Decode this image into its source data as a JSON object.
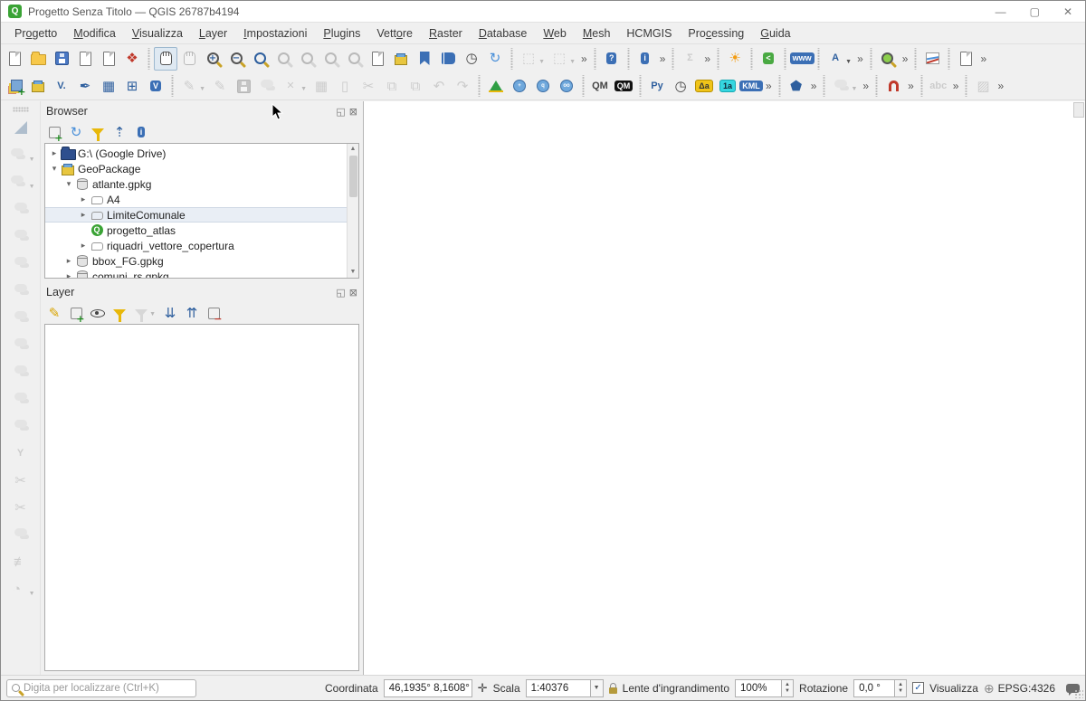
{
  "window": {
    "title": "Progetto Senza Titolo — QGIS 26787b4194",
    "logo_letter": "Q",
    "minimize": "—",
    "maximize": "▢",
    "close": "✕"
  },
  "menubar": [
    {
      "label": "Progetto",
      "u": 2
    },
    {
      "label": "Modifica",
      "u": 0
    },
    {
      "label": "Visualizza",
      "u": 0
    },
    {
      "label": "Layer",
      "u": 0
    },
    {
      "label": "Impostazioni",
      "u": 0
    },
    {
      "label": "Plugins",
      "u": 0
    },
    {
      "label": "Vettore",
      "u": 4
    },
    {
      "label": "Raster",
      "u": 0
    },
    {
      "label": "Database",
      "u": 0
    },
    {
      "label": "Web",
      "u": 0
    },
    {
      "label": "Mesh",
      "u": 0
    },
    {
      "label": "HCMGIS",
      "u": -1
    },
    {
      "label": "Processing",
      "u": 3
    },
    {
      "label": "Guida",
      "u": 0
    }
  ],
  "toolbar_main": [
    {
      "n": "new-project",
      "sh": "sh-doc"
    },
    {
      "n": "open-project",
      "sh": "sh-folder"
    },
    {
      "n": "save-project",
      "sh": "sh-floppy"
    },
    {
      "n": "new-print-layout",
      "sh": "sh-doc"
    },
    {
      "n": "layout-manager",
      "sh": "sh-doc"
    },
    {
      "n": "style-manager",
      "g": "❖",
      "st": "c-red g"
    },
    {
      "sep": true
    },
    {
      "n": "pan-map",
      "sh": "sh-hand",
      "pressed": true
    },
    {
      "n": "pan-to-selection",
      "sh": "sh-hand",
      "dis": true
    },
    {
      "n": "zoom-in",
      "sh": "sh-mag",
      "g": "+"
    },
    {
      "n": "zoom-out",
      "sh": "sh-mag",
      "g": "−"
    },
    {
      "n": "zoom-full-extent",
      "sh": "sh-mag full"
    },
    {
      "n": "zoom-to-selection",
      "sh": "sh-mag",
      "dis": true
    },
    {
      "n": "zoom-to-layer",
      "sh": "sh-mag",
      "dis": true
    },
    {
      "n": "zoom-last",
      "sh": "sh-mag",
      "dis": true
    },
    {
      "n": "zoom-next",
      "sh": "sh-mag",
      "dis": true
    },
    {
      "n": "new-map-view",
      "sh": "sh-doc"
    },
    {
      "n": "new-3d-map-view",
      "sh": "sh-box3d"
    },
    {
      "n": "new-spatial-bookmark",
      "sh": "sh-bkm"
    },
    {
      "n": "show-bookmarks",
      "sh": "sh-book"
    },
    {
      "n": "temporal-controller",
      "g": "◷",
      "st": "c-dark g"
    },
    {
      "n": "refresh-map",
      "g": "↻",
      "st": "c-lblue g"
    },
    {
      "sep": true
    },
    {
      "n": "select-features",
      "g": "⬚",
      "st": "c-grey g",
      "dis": true,
      "dd": true
    },
    {
      "n": "deselect-features",
      "g": "⬚",
      "st": "c-grey g",
      "dis": true,
      "dd": true
    },
    {
      "n": "overflow",
      "g": "»",
      "ovf": true
    },
    {
      "sep": true
    },
    {
      "n": "help-contents",
      "g": "?",
      "st": "chip bg-blue"
    },
    {
      "sep": true
    },
    {
      "n": "identify-features",
      "g": "i",
      "st": "chip bg-blue"
    },
    {
      "n": "overflow",
      "g": "»",
      "ovf": true
    },
    {
      "sep": true
    },
    {
      "n": "statistical-summary",
      "g": "Σ",
      "st": "c-grey g small",
      "dis": true
    },
    {
      "n": "overflow",
      "g": "»",
      "ovf": true
    },
    {
      "sep": true
    },
    {
      "n": "sun-plugin",
      "g": "☀",
      "st": "c-orange g"
    },
    {
      "sep": true
    },
    {
      "n": "share-plugin",
      "g": "<",
      "st": "chip bg-green"
    },
    {
      "sep": true
    },
    {
      "n": "web-plugin",
      "g": "www",
      "st": "chip bg-blue"
    },
    {
      "sep": true
    },
    {
      "n": "labeling",
      "g": "A",
      "st": "c-blue g small",
      "dd": true
    },
    {
      "n": "overflow",
      "g": "»",
      "ovf": true
    },
    {
      "sep": true
    },
    {
      "n": "search-layers-plugin",
      "sh": "sh-mag",
      "stw": "bg-lgreen"
    },
    {
      "n": "overflow",
      "g": "»",
      "ovf": true
    },
    {
      "sep": true
    },
    {
      "n": "profile-tool",
      "sh": "sh-chart"
    },
    {
      "sep": true
    },
    {
      "n": "duplicate-layout",
      "sh": "sh-doc"
    },
    {
      "n": "overflow",
      "g": "»",
      "ovf": true
    }
  ],
  "toolbar_data": [
    {
      "n": "data-source-manager",
      "sh": "sh-stack"
    },
    {
      "n": "new-geopackage",
      "sh": "sh-box3d"
    },
    {
      "n": "new-vector-layer",
      "g": "V.",
      "st": "c-blue g small"
    },
    {
      "n": "new-shapefile",
      "g": "✒",
      "st": "c-blue g"
    },
    {
      "n": "new-spatialite-layer",
      "g": "▦",
      "st": "c-blue g"
    },
    {
      "n": "new-grid-layer",
      "g": "⊞",
      "st": "c-blue g"
    },
    {
      "n": "new-virtual-layer",
      "g": "V",
      "st": "chip bg-blue"
    },
    {
      "sep": true
    },
    {
      "n": "current-edits",
      "g": "✎",
      "st": "c-grey g",
      "dis": true,
      "dd": true
    },
    {
      "n": "toggle-editing",
      "g": "✎",
      "st": "c-grey g",
      "dis": true
    },
    {
      "n": "save-edits",
      "sh": "sh-floppy",
      "dis": true
    },
    {
      "n": "move-feature",
      "sh": "sh-blob",
      "dis": true
    },
    {
      "n": "vertex-tool",
      "g": "✕",
      "st": "c-grey g small",
      "dis": true,
      "dd": true
    },
    {
      "n": "modify-attributes",
      "g": "▦",
      "st": "c-grey g",
      "dis": true
    },
    {
      "n": "delete-selected",
      "g": "▯",
      "st": "c-grey g",
      "dis": true
    },
    {
      "n": "cut-features",
      "g": "✂",
      "st": "c-grey g",
      "dis": true
    },
    {
      "n": "copy-features",
      "g": "⧉",
      "st": "c-grey g",
      "dis": true
    },
    {
      "n": "paste-features",
      "g": "⧉",
      "st": "c-grey g",
      "dis": true
    },
    {
      "n": "undo",
      "g": "↶",
      "st": "c-grey g",
      "dis": true
    },
    {
      "n": "redo",
      "g": "↷",
      "st": "c-grey g",
      "dis": true
    },
    {
      "sep": true
    },
    {
      "n": "measure-triangle-plugin",
      "sh": "sh-tri"
    },
    {
      "n": "globe-add-plugin",
      "sh": "sh-globe",
      "g": "+"
    },
    {
      "n": "globe-search-plugin",
      "sh": "sh-globe",
      "g": "q"
    },
    {
      "n": "globe-binoculars-plugin",
      "sh": "sh-globe",
      "g": "oo"
    },
    {
      "sep": true
    },
    {
      "n": "quickmapservices",
      "g": "QM",
      "st": "c-dark g small"
    },
    {
      "n": "quickmapservices-search",
      "g": "QM",
      "st": "chip bg-black"
    },
    {
      "sep": true
    },
    {
      "n": "python-console",
      "g": "Py",
      "st": "c-blue g small"
    },
    {
      "n": "stopwatch-plugin",
      "g": "◷",
      "st": "c-dark g"
    },
    {
      "n": "autofields-plugin",
      "g": "Δa",
      "st": "chip bg-yellow"
    },
    {
      "n": "numbering-plugin",
      "g": "1a",
      "st": "chip bg-cyan"
    },
    {
      "n": "kml-tools-plugin",
      "g": "KML",
      "st": "chip bg-blue"
    },
    {
      "n": "overflow",
      "g": "»",
      "ovf": true
    },
    {
      "sep": true
    },
    {
      "n": "topology-checker",
      "g": "⬟",
      "st": "c-blue g"
    },
    {
      "n": "overflow",
      "g": "»",
      "ovf": true
    },
    {
      "sep": true
    },
    {
      "n": "georeferencer",
      "sh": "sh-blob",
      "dis": true,
      "dd": true
    },
    {
      "n": "overflow",
      "g": "»",
      "ovf": true
    },
    {
      "sep": true
    },
    {
      "n": "snapping-magnet",
      "sh": "sh-magnet"
    },
    {
      "n": "overflow",
      "g": "»",
      "ovf": true
    },
    {
      "sep": true
    },
    {
      "n": "abc-labels",
      "g": "abc",
      "st": "c-grey g small",
      "dis": true
    },
    {
      "n": "overflow",
      "g": "»",
      "ovf": true
    },
    {
      "sep": true
    },
    {
      "n": "layout-check",
      "g": "▨",
      "st": "c-grey g",
      "dis": true
    },
    {
      "n": "overflow",
      "g": "»",
      "ovf": true
    }
  ],
  "toolbar_left": [
    {
      "n": "set-square-tool",
      "sh": "sh-setsq"
    },
    {
      "n": "node-tool",
      "sh": "sh-blob",
      "dis": true,
      "dd": true
    },
    {
      "n": "move-tool",
      "sh": "sh-blob",
      "dis": true,
      "dd": true
    },
    {
      "n": "shape-tool-1",
      "sh": "sh-blob",
      "dis": true
    },
    {
      "n": "shape-tool-2",
      "sh": "sh-blob",
      "dis": true
    },
    {
      "n": "shape-tool-3",
      "sh": "sh-blob",
      "dis": true
    },
    {
      "n": "shape-tool-4",
      "sh": "sh-blob",
      "dis": true
    },
    {
      "n": "shape-tool-5",
      "sh": "sh-blob",
      "dis": true
    },
    {
      "n": "shape-tool-6",
      "sh": "sh-blob",
      "dis": true
    },
    {
      "n": "shape-tool-7",
      "sh": "sh-blob",
      "dis": true
    },
    {
      "n": "fill-ring-tool",
      "sh": "sh-blob",
      "dis": true
    },
    {
      "n": "offset-curve-tool",
      "sh": "sh-blob",
      "dis": true
    },
    {
      "n": "reshape-tool",
      "g": "Y",
      "st": "c-grey g small",
      "dis": true
    },
    {
      "n": "split-features-tool",
      "g": "✂",
      "st": "c-grey g",
      "dis": true
    },
    {
      "n": "split-parts-tool",
      "g": "✂",
      "st": "c-grey g",
      "dis": true
    },
    {
      "n": "merge-features-tool",
      "sh": "sh-blob",
      "dis": true
    },
    {
      "n": "trace-tool",
      "g": "≢",
      "st": "c-grey g",
      "dis": true
    },
    {
      "n": "circle-arc-tool",
      "g": "◔",
      "st": "c-grey g",
      "dis": true,
      "dd": true
    }
  ],
  "browser": {
    "title": "Browser",
    "float_icon": "◱",
    "close_icon": "⊠",
    "toolbar": [
      {
        "n": "add-selected-layers",
        "sh": "sh-plusbox"
      },
      {
        "n": "refresh-browser",
        "g": "↻",
        "st": "c-lblue g"
      },
      {
        "n": "filter-browser",
        "sh": "sh-funnel"
      },
      {
        "n": "collapse-all",
        "g": "⇡",
        "st": "c-blue g"
      },
      {
        "n": "properties-info",
        "g": "i",
        "st": "chip bg-blue"
      }
    ],
    "tree": [
      {
        "level": 0,
        "exp": "collapsed",
        "icon": "drive-folder",
        "label": "G:\\ (Google Drive)"
      },
      {
        "level": 0,
        "exp": "expanded",
        "icon": "geopackage",
        "label": "GeoPackage"
      },
      {
        "level": 1,
        "exp": "expanded",
        "icon": "database",
        "label": "atlante.gpkg"
      },
      {
        "level": 2,
        "exp": "collapsed",
        "icon": "vector-layer",
        "label": "A4"
      },
      {
        "level": 2,
        "exp": "collapsed",
        "icon": "vector-layer",
        "label": "LimiteComunale",
        "selected": true
      },
      {
        "level": 2,
        "exp": "none",
        "icon": "qgis-project",
        "label": "progetto_atlas"
      },
      {
        "level": 2,
        "exp": "collapsed",
        "icon": "vector-layer",
        "label": "riquadri_vettore_copertura"
      },
      {
        "level": 1,
        "exp": "collapsed",
        "icon": "database",
        "label": "bbox_FG.gpkg"
      },
      {
        "level": 1,
        "exp": "collapsed",
        "icon": "database",
        "label": "comuni_rs.gpkg"
      }
    ]
  },
  "layers_panel": {
    "title": "Layer",
    "float_icon": "◱",
    "close_icon": "⊠",
    "toolbar": [
      {
        "n": "open-layer-styling",
        "g": "✎",
        "st": "c-yellow g"
      },
      {
        "n": "add-group",
        "sh": "sh-plusbox"
      },
      {
        "n": "manage-visibility",
        "sh": "sh-eye"
      },
      {
        "n": "filter-legend",
        "sh": "sh-funnel"
      },
      {
        "n": "filter-by-expression",
        "sh": "sh-funnel greyed",
        "dis": true,
        "dd": true
      },
      {
        "n": "expand-all",
        "g": "⇊",
        "st": "c-blue g"
      },
      {
        "n": "collapse-all-layers",
        "g": "⇈",
        "st": "c-blue g"
      },
      {
        "n": "remove-layer",
        "sh": "sh-minusbox"
      }
    ]
  },
  "statusbar": {
    "search_placeholder": "Digita per localizzare (Ctrl+K)",
    "coordinate_label": "Coordinata",
    "coordinate_value": "46,1935° 8,1608°",
    "scale_label": "Scala",
    "scale_value": "1:40376",
    "magnifier_label": "Lente d'ingrandimento",
    "magnifier_value": "100%",
    "rotation_label": "Rotazione",
    "rotation_value": "0,0 °",
    "render_checkbox_label": "Visualizza",
    "render_checked": "✓",
    "crs_value": "EPSG:4326"
  },
  "colors": {
    "accent_green": "#3aa335",
    "toolbar_bg": "#f0f0f0",
    "selection_bg": "#e9eef5",
    "canvas_bg": "#ffffff"
  }
}
